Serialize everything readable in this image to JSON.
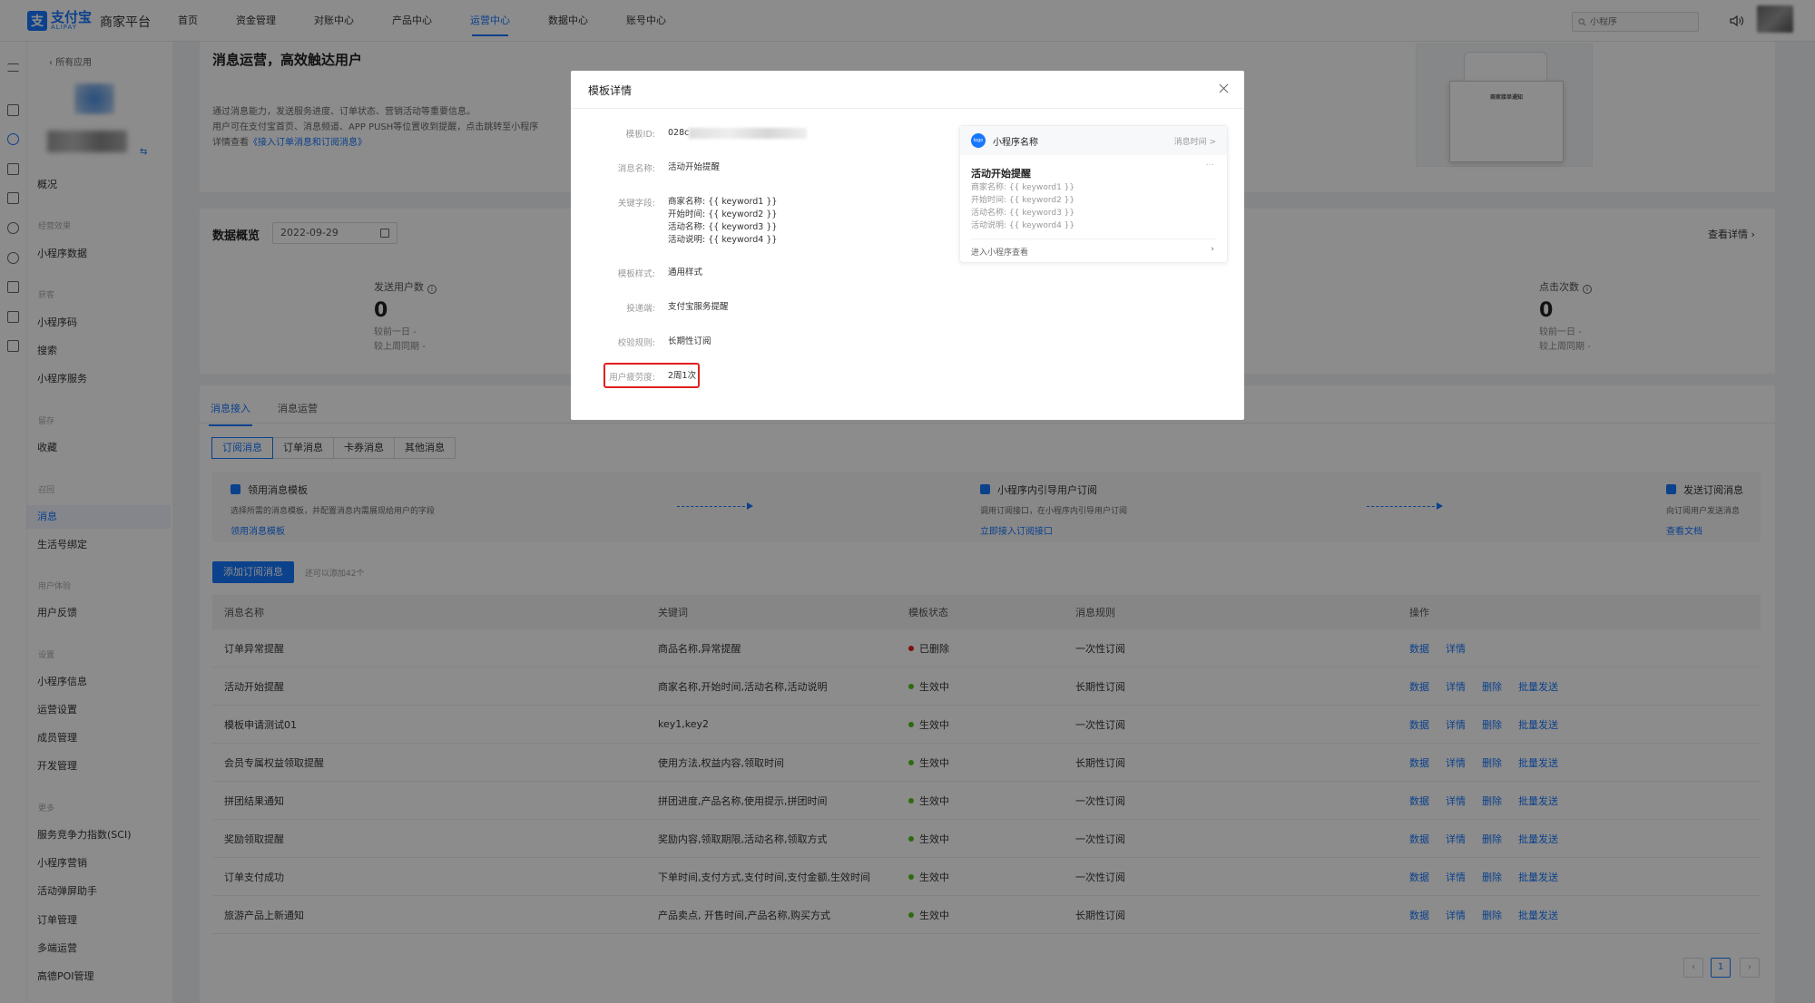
{
  "topbar": {
    "logo_cn": "支付宝",
    "logo_en": "ALIPAY",
    "platform": "商家平台",
    "nav": [
      "首页",
      "资金管理",
      "对账中心",
      "产品中心",
      "运营中心",
      "数据中心",
      "账号中心"
    ],
    "active_nav": "运营中心",
    "search_placeholder": "小程序"
  },
  "sidebar": {
    "back": "所有应用",
    "sections": {
      "overview": "概况",
      "data_section": "经营效果",
      "data_item": "小程序数据",
      "acquire_section": "获客",
      "acquire_items": [
        "小程序码",
        "搜索",
        "小程序服务"
      ],
      "retain_section": "留存",
      "retain_items": [
        "收藏"
      ],
      "reach_section": "召回",
      "reach_items": [
        "消息",
        "生活号绑定"
      ],
      "experience_section": "用户体验",
      "experience_items": [
        "用户反馈"
      ],
      "settings_section": "设置",
      "settings_items": [
        "小程序信息",
        "运营设置",
        "成员管理",
        "开发管理"
      ],
      "more_section": "更多",
      "more_items": [
        "服务竞争力指数(SCI)",
        "小程序营销",
        "活动弹屏助手",
        "订单管理",
        "多端运营",
        "高德POI管理"
      ]
    }
  },
  "hero": {
    "title": "消息运营，高效触达用户",
    "desc1": "通过消息能力，发送服务进度、订单状态、营销活动等重要信息。",
    "desc2": "用户可在支付宝首页、消息频道、APP PUSH等位置收到提醒，点击跳转至小程序",
    "desc3_prefix": "详情查看",
    "desc3_link": "《接入订单消息和订阅消息》",
    "preview_title": "商家接单通知"
  },
  "overview": {
    "title": "数据概览",
    "date": "2022-09-29",
    "detail_link": "查看详情",
    "stats": [
      {
        "label": "发送用户数",
        "value": "0",
        "sub1": "较前一日",
        "sub1_val": "-",
        "sub2": "较上周同期",
        "sub2_val": "-"
      },
      {
        "label": "点击次数",
        "value": "0",
        "sub1": "较前一日",
        "sub1_val": "-",
        "sub2": "较上周同期",
        "sub2_val": "-"
      }
    ]
  },
  "tabs": [
    "消息接入",
    "消息运营"
  ],
  "segments": [
    "订阅消息",
    "订单消息",
    "卡券消息",
    "其他消息"
  ],
  "flow": [
    {
      "title": "领用消息模板",
      "desc": "选择所需的消息模板，并配置消息内需展现给用户的字段",
      "link": "领用消息模板"
    },
    {
      "title": "小程序内引导用户订阅",
      "desc": "调用订阅接口，在小程序内引导用户订阅",
      "link": "立即接入订阅接口"
    },
    {
      "title": "发送订阅消息",
      "desc": "向订阅用户发送消息",
      "link": "查看文档"
    }
  ],
  "add_button": "添加订阅消息",
  "add_hint": "还可以添加42个",
  "table": {
    "headers": [
      "消息名称",
      "关键词",
      "模板状态",
      "消息规则",
      "操作"
    ],
    "rows": [
      {
        "name": "订单异常提醒",
        "keywords": "商品名称,异常提醒",
        "status": "已删除",
        "status_color": "#e02020",
        "rule": "一次性订阅",
        "ops": [
          "数据",
          "详情"
        ]
      },
      {
        "name": "活动开始提醒",
        "keywords": "商家名称,开始时间,活动名称,活动说明",
        "status": "生效中",
        "status_color": "#52c41a",
        "rule": "长期性订阅",
        "ops": [
          "数据",
          "详情",
          "删除",
          "批量发送"
        ]
      },
      {
        "name": "模板申请测试01",
        "keywords": "key1,key2",
        "status": "生效中",
        "status_color": "#52c41a",
        "rule": "一次性订阅",
        "ops": [
          "数据",
          "详情",
          "删除",
          "批量发送"
        ]
      },
      {
        "name": "会员专属权益领取提醒",
        "keywords": "使用方法,权益内容,领取时间",
        "status": "生效中",
        "status_color": "#52c41a",
        "rule": "长期性订阅",
        "ops": [
          "数据",
          "详情",
          "删除",
          "批量发送"
        ]
      },
      {
        "name": "拼团结果通知",
        "keywords": "拼团进度,产品名称,使用提示,拼团时间",
        "status": "生效中",
        "status_color": "#52c41a",
        "rule": "一次性订阅",
        "ops": [
          "数据",
          "详情",
          "删除",
          "批量发送"
        ]
      },
      {
        "name": "奖励领取提醒",
        "keywords": "奖励内容,领取期限,活动名称,领取方式",
        "status": "生效中",
        "status_color": "#52c41a",
        "rule": "一次性订阅",
        "ops": [
          "数据",
          "详情",
          "删除",
          "批量发送"
        ]
      },
      {
        "name": "订单支付成功",
        "keywords": "下单时间,支付方式,支付时间,支付金额,生效时间",
        "status": "生效中",
        "status_color": "#52c41a",
        "rule": "一次性订阅",
        "ops": [
          "数据",
          "详情",
          "删除",
          "批量发送"
        ]
      },
      {
        "name": "旅游产品上新通知",
        "keywords": "产品卖点, 开售时间,产品名称,购买方式",
        "status": "生效中",
        "status_color": "#52c41a",
        "rule": "长期性订阅",
        "ops": [
          "数据",
          "详情",
          "删除",
          "批量发送"
        ]
      }
    ]
  },
  "pagination": {
    "current": "1"
  },
  "modal": {
    "title": "模板详情",
    "fields": {
      "id_label": "模板ID:",
      "id_prefix": "028c",
      "name_label": "消息名称:",
      "name_value": "活动开始提醒",
      "keywords_label": "关键字段:",
      "keywords": [
        "商家名称: {{ keyword1 }}",
        "开始时间: {{ keyword2 }}",
        "活动名称: {{ keyword3 }}",
        "活动说明: {{ keyword4 }}"
      ],
      "style_label": "模板样式:",
      "style_value": "通用样式",
      "channel_label": "投递端:",
      "channel_value": "支付宝服务提醒",
      "rule_label": "校验规则:",
      "rule_value": "长期性订阅",
      "fatigue_label": "用户疲劳度:",
      "fatigue_value": "2周1次"
    },
    "preview": {
      "logo": "logo",
      "app_name": "小程序名称",
      "time": "消息时间 >",
      "more": "···",
      "title": "活动开始提醒",
      "lines": [
        "商家名称: {{ keyword1 }}",
        "开始时间: {{ keyword2 }}",
        "活动名称: {{ keyword3 }}",
        "活动说明: {{ keyword4 }}"
      ],
      "footer": "进入小程序查看"
    }
  }
}
